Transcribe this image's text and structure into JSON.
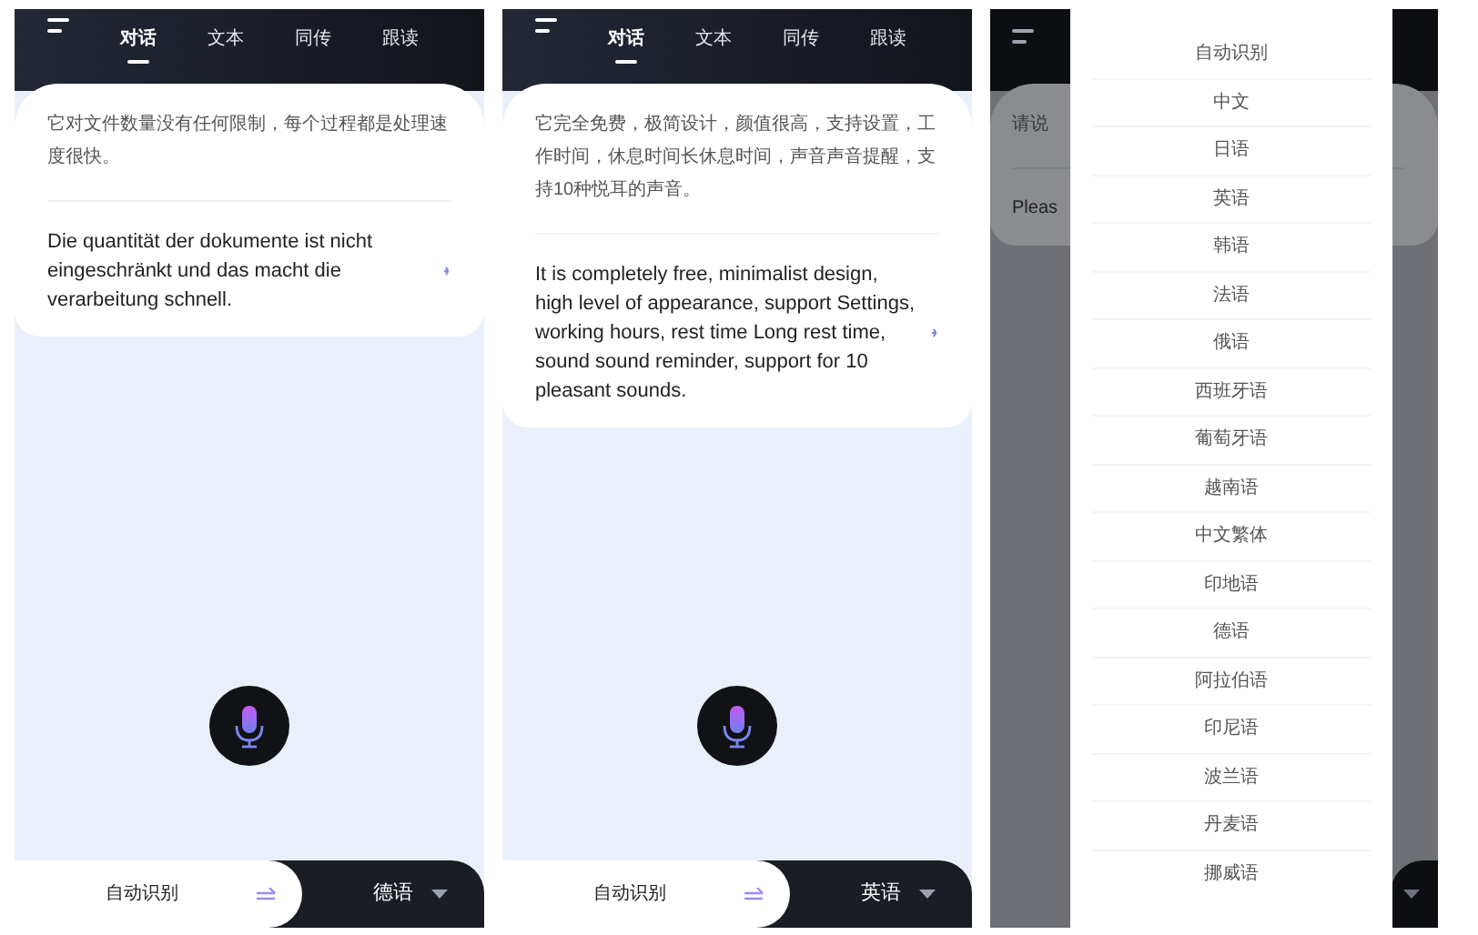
{
  "screens": [
    {
      "kind": "conversation",
      "tabs": [
        {
          "label": "对话",
          "selected": true
        },
        {
          "label": "文本",
          "selected": false
        },
        {
          "label": "同传",
          "selected": false
        },
        {
          "label": "跟读",
          "selected": false
        }
      ],
      "source_text": "它对文件数量没有任何限制，每个过程都是处理速度很快。",
      "translation_text": "Die quantität der dokumente ist nicht eingeschränkt und das macht die verarbeitung schnell.",
      "source_language": "自动识别",
      "target_language": "德语"
    },
    {
      "kind": "conversation",
      "tabs": [
        {
          "label": "对话",
          "selected": true
        },
        {
          "label": "文本",
          "selected": false
        },
        {
          "label": "同传",
          "selected": false
        },
        {
          "label": "跟读",
          "selected": false
        }
      ],
      "source_text": "它完全免费，极简设计，颜值很高，支持设置，工作时间，休息时间长休息时间，声音声音提醒，支持10种悦耳的声音。",
      "translation_text": "It is completely free, minimalist design, high level of appearance, support Settings, working hours, rest time Long rest time, sound sound reminder, support for 10 pleasant sounds.",
      "source_language": "自动识别",
      "target_language": "英语"
    },
    {
      "kind": "language_picker",
      "source_text": "请说",
      "translation_text": "Pleas",
      "languages": [
        "自动识别",
        "中文",
        "日语",
        "英语",
        "韩语",
        "法语",
        "俄语",
        "西班牙语",
        "葡萄牙语",
        "越南语",
        "中文繁体",
        "印地语",
        "德语",
        "阿拉伯语",
        "印尼语",
        "波兰语",
        "丹麦语",
        "挪威语"
      ]
    }
  ]
}
